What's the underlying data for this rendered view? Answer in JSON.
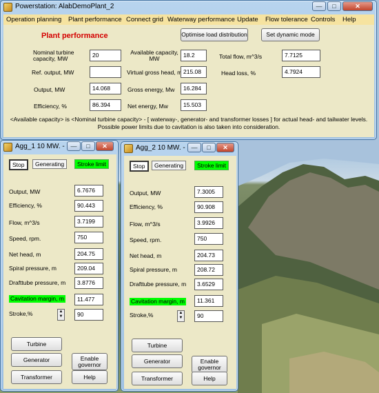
{
  "main_window": {
    "title": "Powerstation: AlabDemoPlant_2",
    "menu": [
      "Operation planning",
      "Plant performance",
      "Connect grid",
      "Waterway performance",
      "Update",
      "Flow tolerance",
      "Controls",
      "Help"
    ],
    "header": "Plant performance",
    "btn_optimise": "Optimise load distribution",
    "btn_dynamic": "Set dynamic mode",
    "fields": {
      "nominal_turbine_label": "Nominal turbine capacity, MW",
      "nominal_turbine_value": "20",
      "ref_output_label": "Ref. output, MW",
      "ref_output_value": "",
      "output_label": "Output, MW",
      "output_value": "14.068",
      "efficiency_label": "Efficiency, %",
      "efficiency_value": "86.394",
      "available_capacity_label": "Available capacity, MW",
      "available_capacity_value": "18.2",
      "virtual_gross_head_label": "Virtual gross head, m",
      "virtual_gross_head_value": "215.08",
      "gross_energy_label": "Gross energy, Mw",
      "gross_energy_value": "16.284",
      "net_energy_label": "Net energy, Mw",
      "net_energy_value": "15.503",
      "total_flow_label": "Total flow, m^3/s",
      "total_flow_value": "7.7125",
      "head_loss_label": "Head loss, %",
      "head_loss_value": "4.7924"
    },
    "note": "<Available capacity> is <Nominal turbine capacity> - [ waterway-, generator- and transformer losses ] for actual head- and tailwater levels. Possible power limits due to cavitation is also taken into consideration."
  },
  "agg1": {
    "title": "Agg_1 10 MW. - ...",
    "tab_stop": "Stop",
    "tab_generating": "Generating",
    "stroke_limit": "Stroke limit",
    "output_label": "Output, MW",
    "output_value": "6.7676",
    "efficiency_label": "Efficiency, %",
    "efficiency_value": "90.443",
    "flow_label": "Flow, m^3/s",
    "flow_value": "3.7199",
    "speed_label": "Speed, rpm.",
    "speed_value": "750",
    "net_head_label": "Net head, m",
    "net_head_value": "204.75",
    "spiral_label": "Spiral pressure, m",
    "spiral_value": "209.04",
    "drafttube_label": "Drafttube pressure, m",
    "drafttube_value": "3.8776",
    "cavitation_label": "Cavitation margin, m",
    "cavitation_value": "11.477",
    "stroke_label": "Stroke,%",
    "stroke_value": "90",
    "btn_turbine": "Turbine",
    "btn_generator": "Generator",
    "btn_enable": "Enable governor",
    "btn_transformer": "Transformer",
    "btn_help": "Help"
  },
  "agg2": {
    "title": "Agg_2 10 MW. - ...",
    "tab_stop": "Stop",
    "tab_generating": "Generating",
    "stroke_limit": "Stroke limit",
    "output_label": "Output, MW",
    "output_value": "7.3005",
    "efficiency_label": "Efficiency, %",
    "efficiency_value": "90.908",
    "flow_label": "Flow, m^3/s",
    "flow_value": "3.9926",
    "speed_label": "Speed, rpm.",
    "speed_value": "750",
    "net_head_label": "Net head, m",
    "net_head_value": "204.73",
    "spiral_label": "Spiral pressure, m",
    "spiral_value": "208.72",
    "drafttube_label": "Drafttube pressure, m",
    "drafttube_value": "3.6529",
    "cavitation_label": "Cavitation margin, m",
    "cavitation_value": "11.361",
    "stroke_label": "Stroke,%",
    "stroke_value": "90",
    "btn_turbine": "Turbine",
    "btn_generator": "Generator",
    "btn_enable": "Enable governor",
    "btn_transformer": "Transformer",
    "btn_help": "Help"
  },
  "colors": {
    "panel": "#ece8c7",
    "menubar": "#f6e3a0",
    "highlight": "#00ff00",
    "header": "#d40000"
  }
}
